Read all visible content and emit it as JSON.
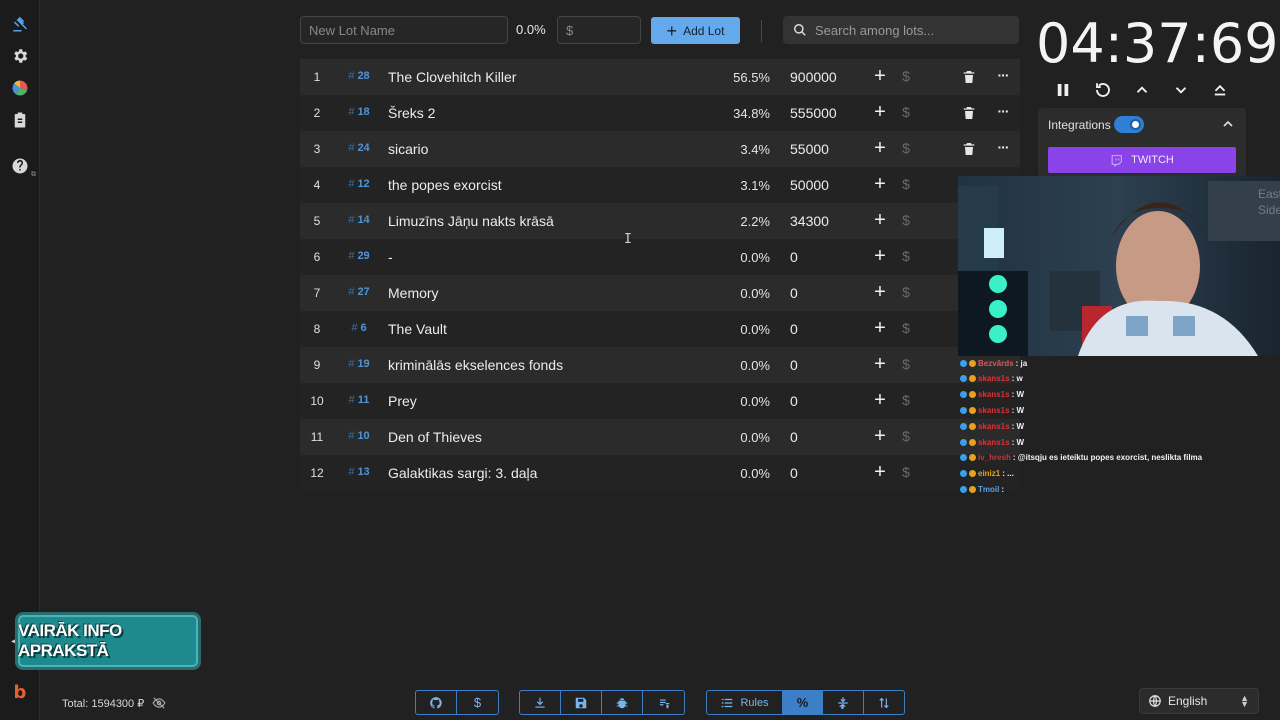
{
  "toolbar": {
    "lot_name_placeholder": "New Lot Name",
    "new_lot_percent": "0.0%",
    "amount_placeholder": "$",
    "add_lot_label": "Add Lot",
    "search_placeholder": "Search among lots..."
  },
  "lots": [
    {
      "index": "1",
      "id": "28",
      "name": "The Clovehitch Killer",
      "percent": "56.5%",
      "amount": "900000",
      "deletable": true
    },
    {
      "index": "2",
      "id": "18",
      "name": "Šreks 2",
      "percent": "34.8%",
      "amount": "555000",
      "deletable": true
    },
    {
      "index": "3",
      "id": "24",
      "name": "sicario",
      "percent": "3.4%",
      "amount": "55000",
      "deletable": true
    },
    {
      "index": "4",
      "id": "12",
      "name": "the popes exorcist",
      "percent": "3.1%",
      "amount": "50000",
      "deletable": false
    },
    {
      "index": "5",
      "id": "14",
      "name": "Limuzīns Jāņu nakts krāsā",
      "percent": "2.2%",
      "amount": "34300",
      "deletable": false
    },
    {
      "index": "6",
      "id": "29",
      "name": "-",
      "percent": "0.0%",
      "amount": "0",
      "deletable": false
    },
    {
      "index": "7",
      "id": "27",
      "name": "Memory",
      "percent": "0.0%",
      "amount": "0",
      "deletable": false
    },
    {
      "index": "8",
      "id": "6",
      "name": "The Vault",
      "percent": "0.0%",
      "amount": "0",
      "deletable": false
    },
    {
      "index": "9",
      "id": "19",
      "name": "kriminālās ekselences fonds",
      "percent": "0.0%",
      "amount": "0",
      "deletable": false
    },
    {
      "index": "10",
      "id": "11",
      "name": "Prey",
      "percent": "0.0%",
      "amount": "0",
      "deletable": false
    },
    {
      "index": "11",
      "id": "10",
      "name": "Den of Thieves",
      "percent": "0.0%",
      "amount": "0",
      "deletable": false
    },
    {
      "index": "12",
      "id": "13",
      "name": "Galaktikas sargi: 3. daļa",
      "percent": "0.0%",
      "amount": "0",
      "deletable": false
    }
  ],
  "timer": {
    "display": "04:37:69"
  },
  "integrations": {
    "label": "Integrations",
    "enabled": true,
    "twitch_label": "TWITCH",
    "twitch_color": "#8a43e8"
  },
  "chat": [
    {
      "user": "Bezvārds",
      "message": ": ja",
      "user_color": "#e05555"
    },
    {
      "user": "skans1s",
      "message": ": w",
      "user_color": "#e03030"
    },
    {
      "user": "skans1s",
      "message": ": W",
      "user_color": "#e03030"
    },
    {
      "user": "skans1s",
      "message": ": W",
      "user_color": "#e03030"
    },
    {
      "user": "skans1s",
      "message": ": W",
      "user_color": "#e03030"
    },
    {
      "user": "skans1s",
      "message": ": W",
      "user_color": "#e03030"
    },
    {
      "user": "iv_hresh",
      "message": ": @itsqju es ieteiktu popes exorcist, neslikta filma",
      "user_color": "#c23b3b"
    },
    {
      "user": "einiz1",
      "message": ": ...",
      "user_color": "#e8a020"
    },
    {
      "user": "Tmoil",
      "message": ":",
      "user_color": "#5aa0e6"
    }
  ],
  "promo": {
    "text": "VAIRĀK INFO APRAKSTĀ"
  },
  "footer": {
    "total_label": "Total: 1594300 ₽",
    "rules_label": "Rules",
    "language": "English"
  },
  "icons": {
    "nav": [
      "gavel-icon",
      "gear-icon",
      "pie-chart-icon",
      "clipboard-icon",
      "help-icon"
    ],
    "lot_actions": [
      "plus-icon",
      "dollar-icon",
      "trash-icon",
      "ellipsis-icon"
    ],
    "timer_controls": [
      "pause-icon",
      "reset-icon",
      "chevron-up-icon",
      "chevron-down-icon",
      "eject-icon"
    ],
    "footer": [
      "github-icon",
      "donate-icon",
      "download-icon",
      "save-icon",
      "bug-icon",
      "clear-icon",
      "rules-icon",
      "percent-icon",
      "compress-icon",
      "sort-icon",
      "globe-icon"
    ]
  },
  "colors": {
    "accent": "#64a9ec",
    "lot_id": "#4f95d8",
    "background": "#212121"
  }
}
